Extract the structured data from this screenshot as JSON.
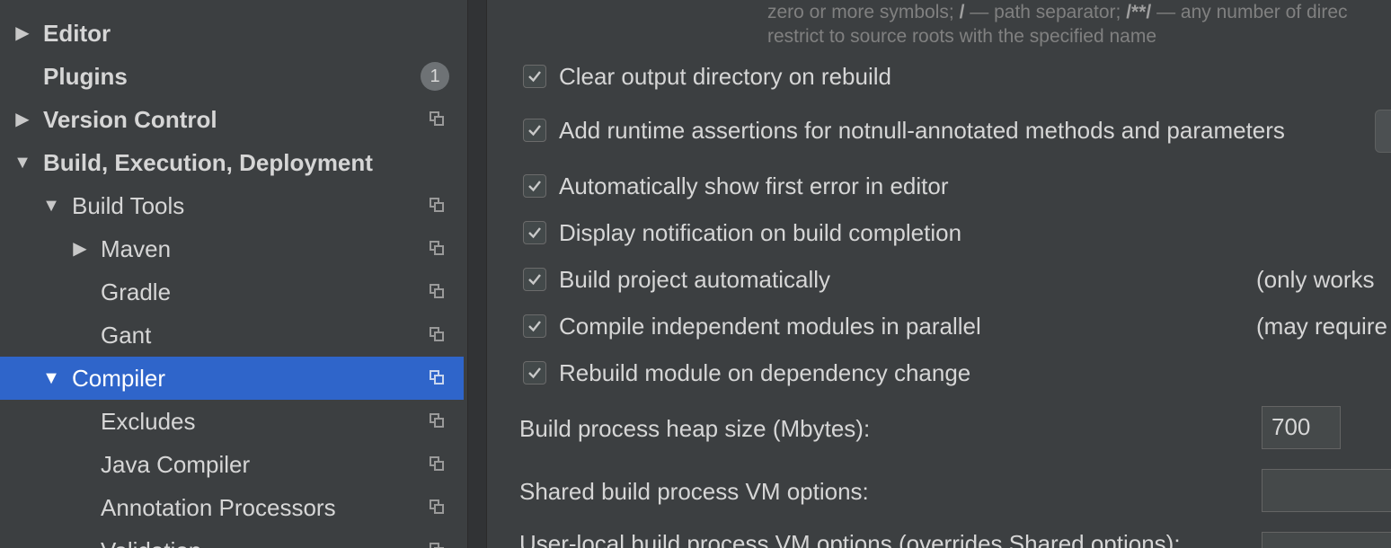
{
  "sidebar": {
    "items": [
      {
        "label": "Editor",
        "expanded": false
      },
      {
        "label": "Plugins",
        "badge": "1"
      },
      {
        "label": "Version Control",
        "expanded": false
      },
      {
        "label": "Build, Execution, Deployment",
        "expanded": true
      },
      {
        "label": "Build Tools",
        "expanded": true
      },
      {
        "label": "Maven",
        "expanded": false
      },
      {
        "label": "Gradle"
      },
      {
        "label": "Gant"
      },
      {
        "label": "Compiler",
        "expanded": true,
        "selected": true
      },
      {
        "label": "Excludes"
      },
      {
        "label": "Java Compiler"
      },
      {
        "label": "Annotation Processors"
      },
      {
        "label": "Validation"
      }
    ]
  },
  "content": {
    "hint_line1_a": "zero or more symbols;",
    "hint_line1_b": "/",
    "hint_line1_c": "— path separator;",
    "hint_line1_d": "/**/",
    "hint_line1_e": "— any number of direc",
    "hint_line2": "restrict to source roots with the specified name",
    "options": [
      {
        "label": "Clear output directory on rebuild",
        "checked": true
      },
      {
        "label": "Add runtime assertions for notnull-annotated methods and parameters",
        "checked": true
      },
      {
        "label": "Automatically show first error in editor",
        "checked": true
      },
      {
        "label": "Display notification on build completion",
        "checked": true
      },
      {
        "label": "Build project automatically",
        "checked": true,
        "note": "(only works"
      },
      {
        "label": "Compile independent modules in parallel",
        "checked": true,
        "note": "(may require"
      },
      {
        "label": "Rebuild module on dependency change",
        "checked": true
      }
    ],
    "heap_label": "Build process heap size (Mbytes):",
    "heap_value": "700",
    "vm_label": "Shared build process VM options:",
    "vm_value": "",
    "user_vm_label": "User-local build process VM options (overrides Shared options):"
  },
  "colors": {
    "background": "#3c3f41",
    "selection": "#2f65ca",
    "text": "#d6d6d6"
  }
}
